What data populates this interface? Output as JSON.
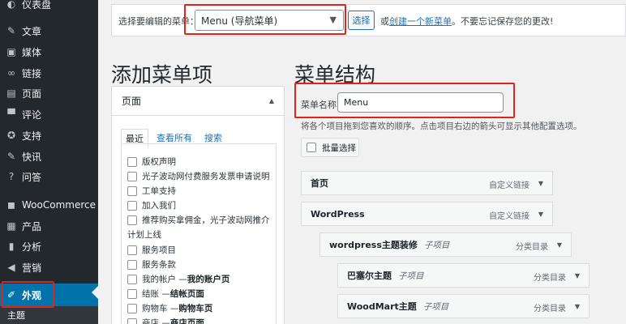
{
  "sidebar": {
    "items": [
      {
        "label": "仪表盘",
        "icon": "dashboard-icon",
        "glyph": "◐"
      },
      {
        "label": "文章",
        "icon": "pin-icon",
        "glyph": "✎"
      },
      {
        "label": "媒体",
        "icon": "media-icon",
        "glyph": "▣"
      },
      {
        "label": "链接",
        "icon": "link-icon",
        "glyph": "∞"
      },
      {
        "label": "页面",
        "icon": "page-icon",
        "glyph": "▤"
      },
      {
        "label": "评论",
        "icon": "comment-icon",
        "glyph": "▀"
      },
      {
        "label": "支持",
        "icon": "support-icon",
        "glyph": "✪"
      },
      {
        "label": "快讯",
        "icon": "pin-icon",
        "glyph": "✎"
      },
      {
        "label": "问答",
        "icon": "question-icon",
        "glyph": "?"
      },
      {
        "label": "WooCommerce",
        "icon": "woocommerce-icon",
        "glyph": "◼"
      },
      {
        "label": "产品",
        "icon": "box-icon",
        "glyph": "▦"
      },
      {
        "label": "分析",
        "icon": "chart-icon",
        "glyph": "▮"
      },
      {
        "label": "营销",
        "icon": "megaphone-icon",
        "glyph": "◀"
      },
      {
        "label": "外观",
        "icon": "brush-icon",
        "glyph": "✐"
      }
    ],
    "sub_item": "主题"
  },
  "topbar": {
    "label": "选择要编辑的菜单：",
    "selected_menu": "Menu (导航菜单)",
    "select_button": "选择",
    "hint_prefix": "或",
    "hint_link": "创建一个新菜单",
    "hint_suffix": "。不要忘记保存您的更改!"
  },
  "headings": {
    "add_items": "添加菜单项",
    "structure": "菜单结构"
  },
  "add_panel": {
    "title": "页面",
    "tabs": [
      "最近",
      "查看所有",
      "搜索"
    ],
    "pages": [
      {
        "text": "版权声明"
      },
      {
        "text": "光子波动网付费服务发票申请说明"
      },
      {
        "text": "工单支持"
      },
      {
        "text": "加入我们"
      },
      {
        "text": "推荐购买拿佣金，光子波动网推介",
        "wrap": "计划上线"
      },
      {
        "text": "服务项目"
      },
      {
        "text": "服务条款"
      },
      {
        "text": "我的帐户 — ",
        "bold": "我的账户页"
      },
      {
        "text": "结账 — ",
        "bold": "结帐页面"
      },
      {
        "text": "购物车 — ",
        "bold": "购物车页"
      },
      {
        "text": "商店 — ",
        "bold": "商店页面"
      }
    ]
  },
  "structure": {
    "name_label": "菜单名称",
    "name_value": "Menu",
    "description": "将各个项目拖到您喜欢的顺序。点击项目右边的箭头可显示其他配置选项。",
    "bulk_select": "批量选择",
    "items": [
      {
        "title": "首页",
        "sub": "",
        "type": "自定义链接"
      },
      {
        "title": "WordPress",
        "sub": "",
        "type": "自定义链接"
      },
      {
        "title": "wordpress主题装修",
        "sub": "子项目",
        "type": "分类目录"
      },
      {
        "title": "巴塞尔主题",
        "sub": "子项目",
        "type": "分类目录"
      },
      {
        "title": "WoodMart主题",
        "sub": "子项目",
        "type": "分类目录"
      }
    ]
  }
}
